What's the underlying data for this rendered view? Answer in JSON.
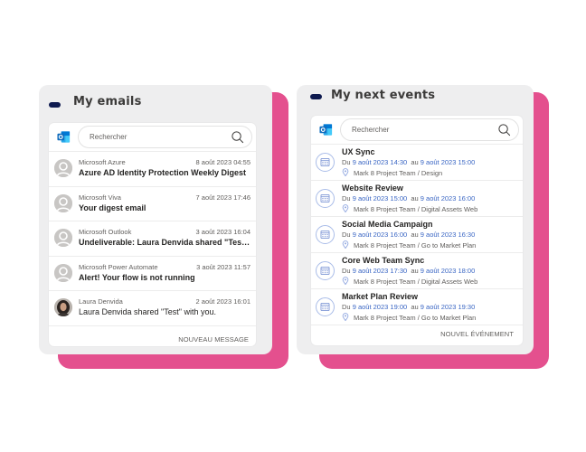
{
  "colors": {
    "accent_pink": "#e4508e",
    "panel_bg": "#eeeeef",
    "dash": "#0e1a4f",
    "link_blue": "#3a66c4",
    "outlook_blue": "#0f6cbd"
  },
  "emails_panel": {
    "title": "My emails",
    "search_placeholder": "Rechercher",
    "items": [
      {
        "sender": "Microsoft Azure",
        "date": "8 août 2023 04:55",
        "subject": "Azure AD Identity Protection Weekly Digest",
        "avatar": "default-avatar-icon",
        "unread": true
      },
      {
        "sender": "Microsoft Viva",
        "date": "7 août 2023 17:46",
        "subject": "Your digest email",
        "avatar": "default-avatar-icon",
        "unread": true
      },
      {
        "sender": "Microsoft Outlook",
        "date": "3 août 2023 16:04",
        "subject": "Undeliverable: Laura Denvida shared \"Test\" w...",
        "avatar": "default-avatar-icon",
        "unread": true
      },
      {
        "sender": "Microsoft Power Automate",
        "date": "3 août 2023 11:57",
        "subject": "Alert! Your flow is not running",
        "avatar": "default-avatar-icon",
        "unread": true
      },
      {
        "sender": "Laura Denvida",
        "date": "2 août 2023 16:01",
        "subject": "Laura Denvida shared \"Test\" with you.",
        "avatar": "photo-avatar",
        "unread": false
      }
    ],
    "footer_action": "NOUVEAU MESSAGE"
  },
  "events_panel": {
    "title": "My next events",
    "search_placeholder": "Rechercher",
    "from_label": "Du",
    "to_label": "au",
    "items": [
      {
        "title": "UX Sync",
        "start": "9 août 2023 14:30",
        "end": "9 août 2023 15:00",
        "location": "Mark 8 Project Team / Design"
      },
      {
        "title": "Website Review",
        "start": "9 août 2023 15:00",
        "end": "9 août 2023 16:00",
        "location": "Mark 8 Project Team / Digital Assets Web"
      },
      {
        "title": "Social Media Campaign",
        "start": "9 août 2023 16:00",
        "end": "9 août 2023 16:30",
        "location": "Mark 8 Project Team / Go to Market Plan"
      },
      {
        "title": "Core Web Team Sync",
        "start": "9 août 2023 17:30",
        "end": "9 août 2023 18:00",
        "location": "Mark 8 Project Team / Digital Assets Web"
      },
      {
        "title": "Market Plan Review",
        "start": "9 août 2023 19:00",
        "end": "9 août 2023 19:30",
        "location": "Mark 8 Project Team / Go to Market Plan"
      }
    ],
    "footer_action": "NOUVEL ÉVÉNEMENT"
  }
}
